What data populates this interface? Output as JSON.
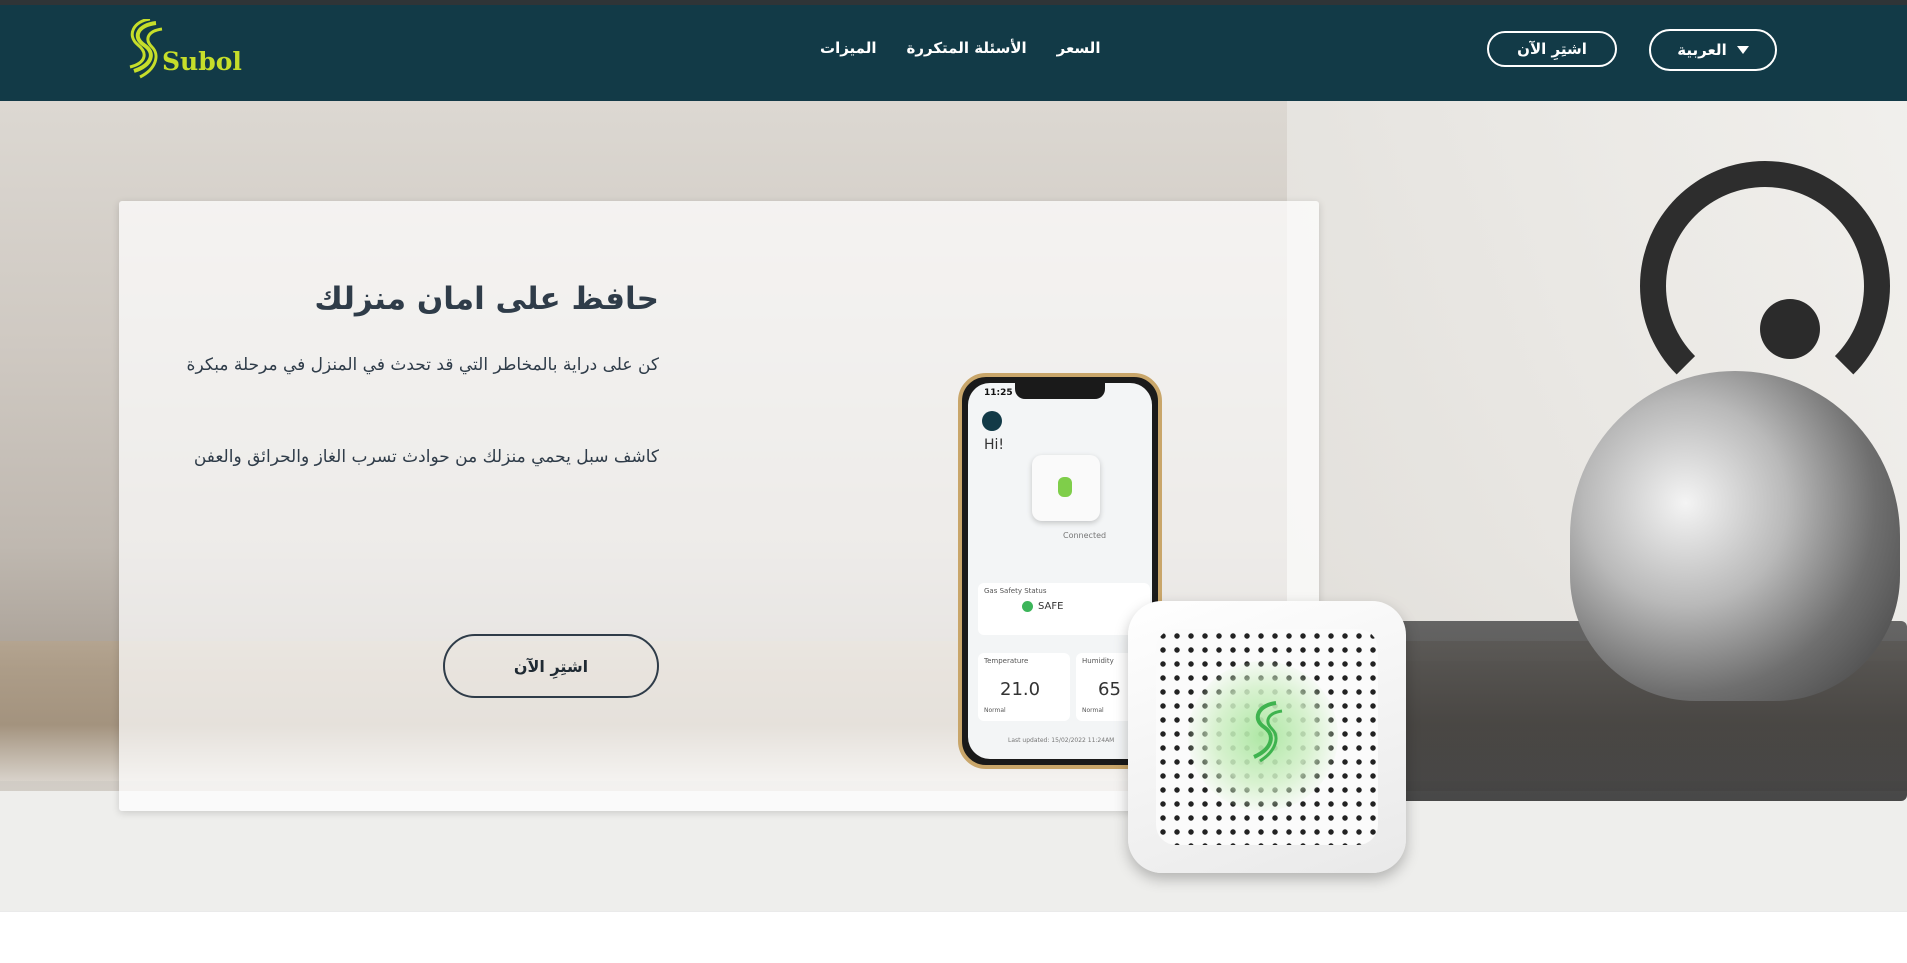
{
  "brand": {
    "name": "Subol",
    "accent": "#c6de2a",
    "navbar_color": "#123a47"
  },
  "nav": {
    "links": [
      "الميزات",
      "الأسئلة المتكررة",
      "السعر"
    ],
    "buy_label": "اشتِرِ الآن",
    "language": "العربية"
  },
  "hero": {
    "title": "حافظ على امان منزلك",
    "line1": "كن على دراية بالمخاطر التي قد تحدث في المنزل في مرحلة مبكرة",
    "line2": "كاشف سبل يحمي منزلك من حوادث تسرب الغاز والحرائق والعفن",
    "buy_label": "اشتِرِ الآن"
  },
  "phone": {
    "time": "11:25",
    "greeting": "Hi!",
    "connection": "Connected",
    "gas_label": "Gas Safety Status",
    "gas_status": "SAFE",
    "temp_label": "Temperature",
    "temp_value": "21.0",
    "temp_state": "Normal",
    "humidity_label": "Humidity",
    "humidity_value": "65",
    "humidity_state": "Normal",
    "updated": "Last updated: 15/02/2022 11:24AM"
  }
}
